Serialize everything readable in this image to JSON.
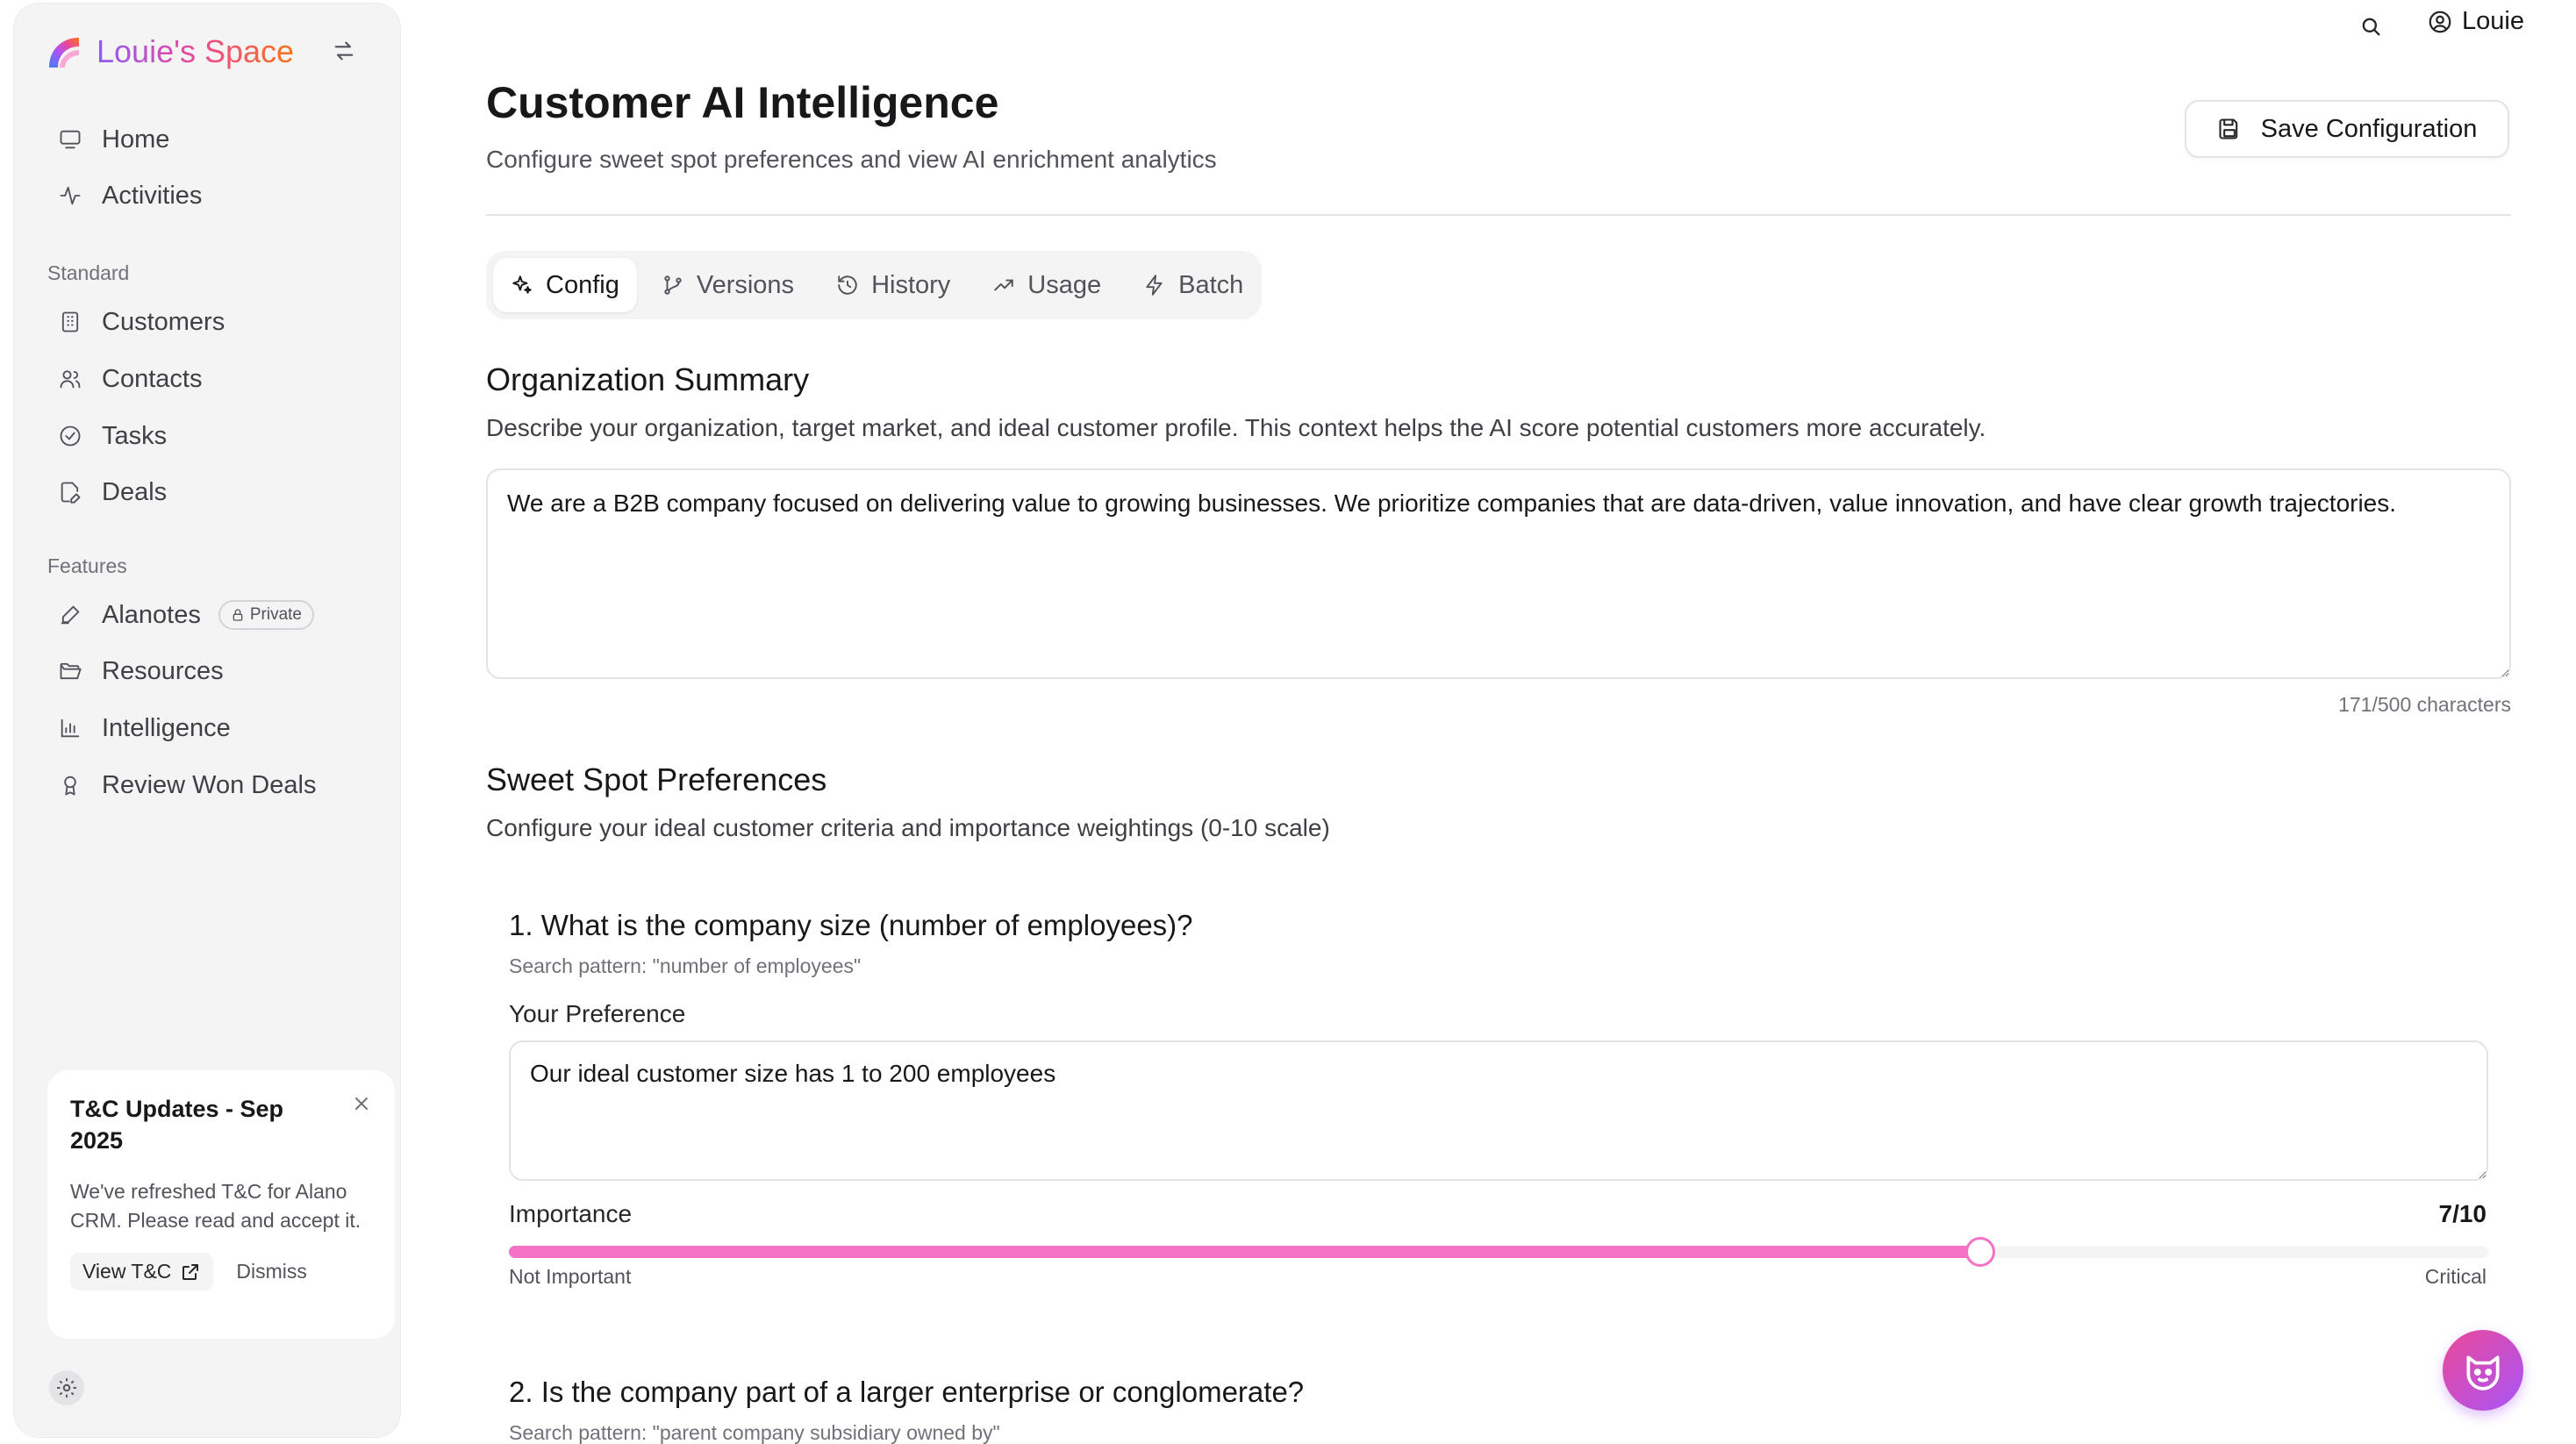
{
  "brand": {
    "name": "Louie's Space"
  },
  "sidebar": {
    "top_items": [
      {
        "label": "Home"
      },
      {
        "label": "Activities"
      }
    ],
    "standard_label": "Standard",
    "standard_items": [
      {
        "label": "Customers"
      },
      {
        "label": "Contacts"
      },
      {
        "label": "Tasks"
      },
      {
        "label": "Deals"
      }
    ],
    "features_label": "Features",
    "feature_items": [
      {
        "label": "Alanotes",
        "badge": "Private"
      },
      {
        "label": "Resources"
      },
      {
        "label": "Intelligence"
      },
      {
        "label": "Review Won Deals"
      }
    ]
  },
  "tc_card": {
    "title": "T&C Updates - Sep 2025",
    "body": "We've refreshed T&C for Alano CRM. Please read and accept it.",
    "view_label": "View T&C",
    "dismiss_label": "Dismiss"
  },
  "topbar": {
    "user_name": "Louie"
  },
  "page": {
    "title": "Customer AI Intelligence",
    "subtitle": "Configure sweet spot preferences and view AI enrichment analytics",
    "save_label": "Save Configuration"
  },
  "tabs": [
    {
      "label": "Config",
      "active": true
    },
    {
      "label": "Versions"
    },
    {
      "label": "History"
    },
    {
      "label": "Usage"
    },
    {
      "label": "Batch"
    }
  ],
  "org_summary": {
    "heading": "Organization Summary",
    "description": "Describe your organization, target market, and ideal customer profile. This context helps the AI score potential customers more accurately.",
    "value": "We are a B2B company focused on delivering value to growing businesses. We prioritize companies that are data-driven, value innovation, and have clear growth trajectories.",
    "char_count": "171/500 characters"
  },
  "sweet_spot": {
    "heading": "Sweet Spot Preferences",
    "description": "Configure your ideal customer criteria and importance weightings (0-10 scale)",
    "questions": [
      {
        "title": "1. What is the company size (number of employees)?",
        "pattern": "Search pattern: \"number of employees\"",
        "preference_label": "Your Preference",
        "preference_value": "Our ideal customer size has 1 to 200 employees",
        "importance_label": "Importance",
        "importance": 7,
        "importance_max": 10,
        "importance_display": "7/10",
        "min_label": "Not Important",
        "max_label": "Critical"
      },
      {
        "title": "2. Is the company part of a larger enterprise or conglomerate?",
        "pattern": "Search pattern: \"parent company subsidiary owned by\""
      }
    ]
  },
  "colors": {
    "accent": "#f472c6",
    "brand_gradient_start": "#8b5cf6",
    "brand_gradient_end": "#f97316"
  }
}
